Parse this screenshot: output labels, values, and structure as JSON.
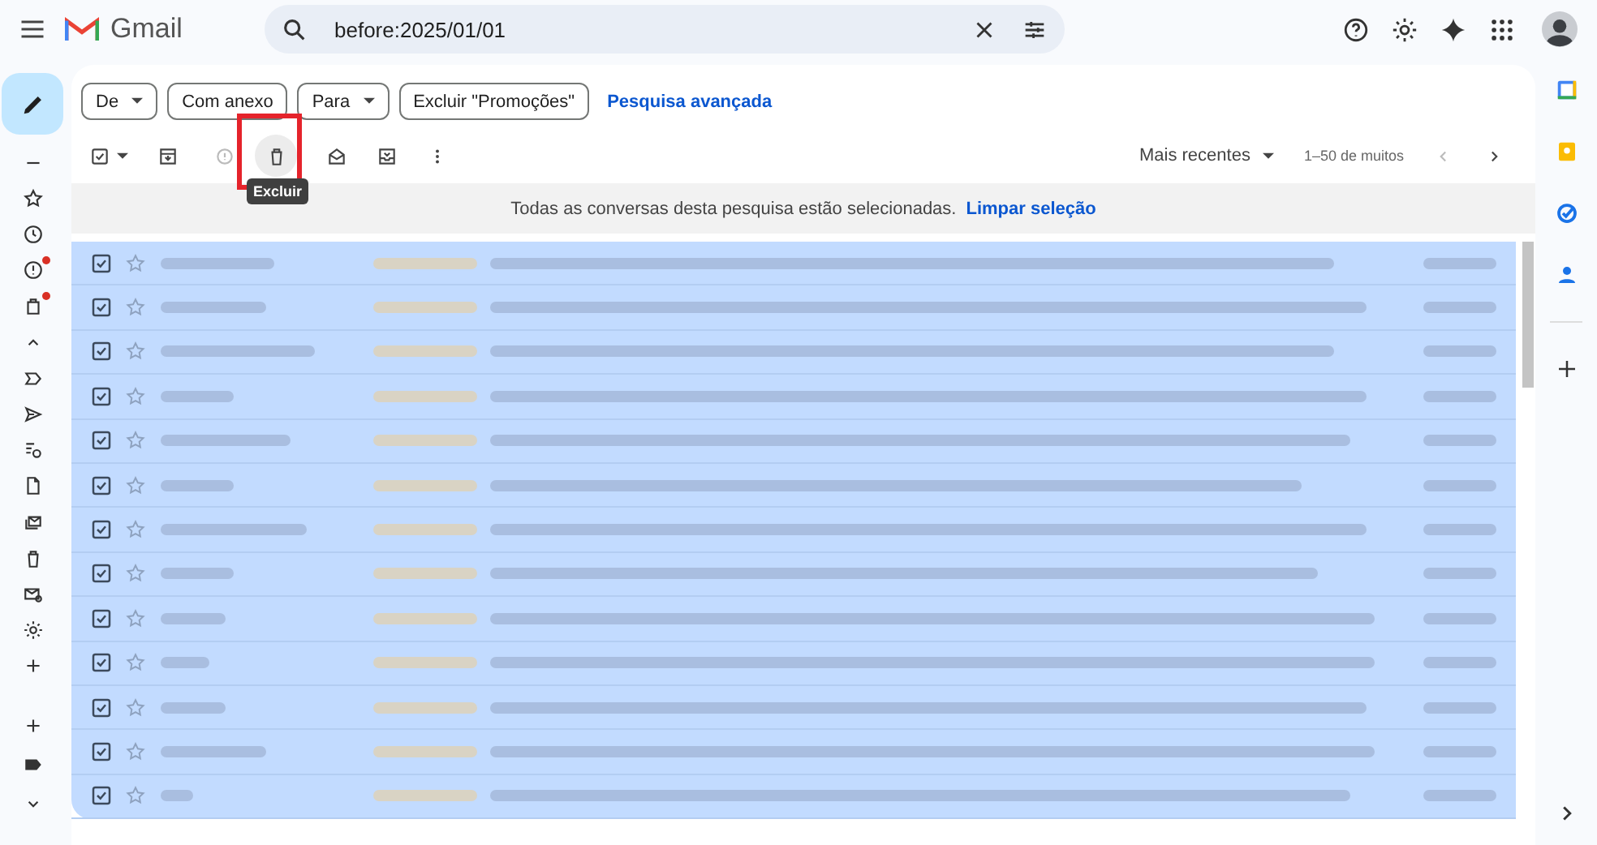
{
  "app": {
    "name": "Gmail"
  },
  "search": {
    "value": "before:2025/01/01"
  },
  "filters": [
    {
      "label": "De",
      "kind": "dropdown"
    },
    {
      "label": "Com anexo",
      "kind": "chip"
    },
    {
      "label": "Para",
      "kind": "dropdown"
    },
    {
      "label": "Excluir \"Promoções\"",
      "kind": "chip"
    }
  ],
  "advanced_search": "Pesquisa avançada",
  "toolbar": {
    "select_all_checked": true,
    "tooltip": "Excluir",
    "delete_highlighted": true,
    "sort": "Mais recentes",
    "range": "1–50 de muitos"
  },
  "banner": {
    "text": "Todas as conversas desta pesquisa estão selecionadas.",
    "link": "Limpar seleção"
  },
  "nav_items": [
    {
      "kind": "minus",
      "badge": false
    },
    {
      "kind": "star",
      "badge": false
    },
    {
      "kind": "clock",
      "badge": false
    },
    {
      "kind": "important",
      "badge": true
    },
    {
      "kind": "bag",
      "badge": true
    },
    {
      "kind": "chevron-up",
      "badge": false
    },
    {
      "kind": "label-arrow",
      "badge": false
    },
    {
      "kind": "send",
      "badge": false
    },
    {
      "kind": "scheduled",
      "badge": false
    },
    {
      "kind": "doc",
      "badge": false
    },
    {
      "kind": "mail-stack",
      "badge": false
    },
    {
      "kind": "trash",
      "badge": false
    },
    {
      "kind": "spam-mail",
      "badge": false
    },
    {
      "kind": "gear",
      "badge": false
    },
    {
      "kind": "plus",
      "badge": false
    }
  ],
  "rows": [
    {
      "checked": true,
      "starred": false
    },
    {
      "checked": true,
      "starred": false
    },
    {
      "checked": true,
      "starred": false
    },
    {
      "checked": true,
      "starred": false
    },
    {
      "checked": true,
      "starred": false
    },
    {
      "checked": true,
      "starred": false
    },
    {
      "checked": true,
      "starred": false
    },
    {
      "checked": true,
      "starred": false
    },
    {
      "checked": true,
      "starred": false
    },
    {
      "checked": true,
      "starred": false
    },
    {
      "checked": true,
      "starred": false
    },
    {
      "checked": true,
      "starred": false
    },
    {
      "checked": true,
      "starred": false
    }
  ]
}
